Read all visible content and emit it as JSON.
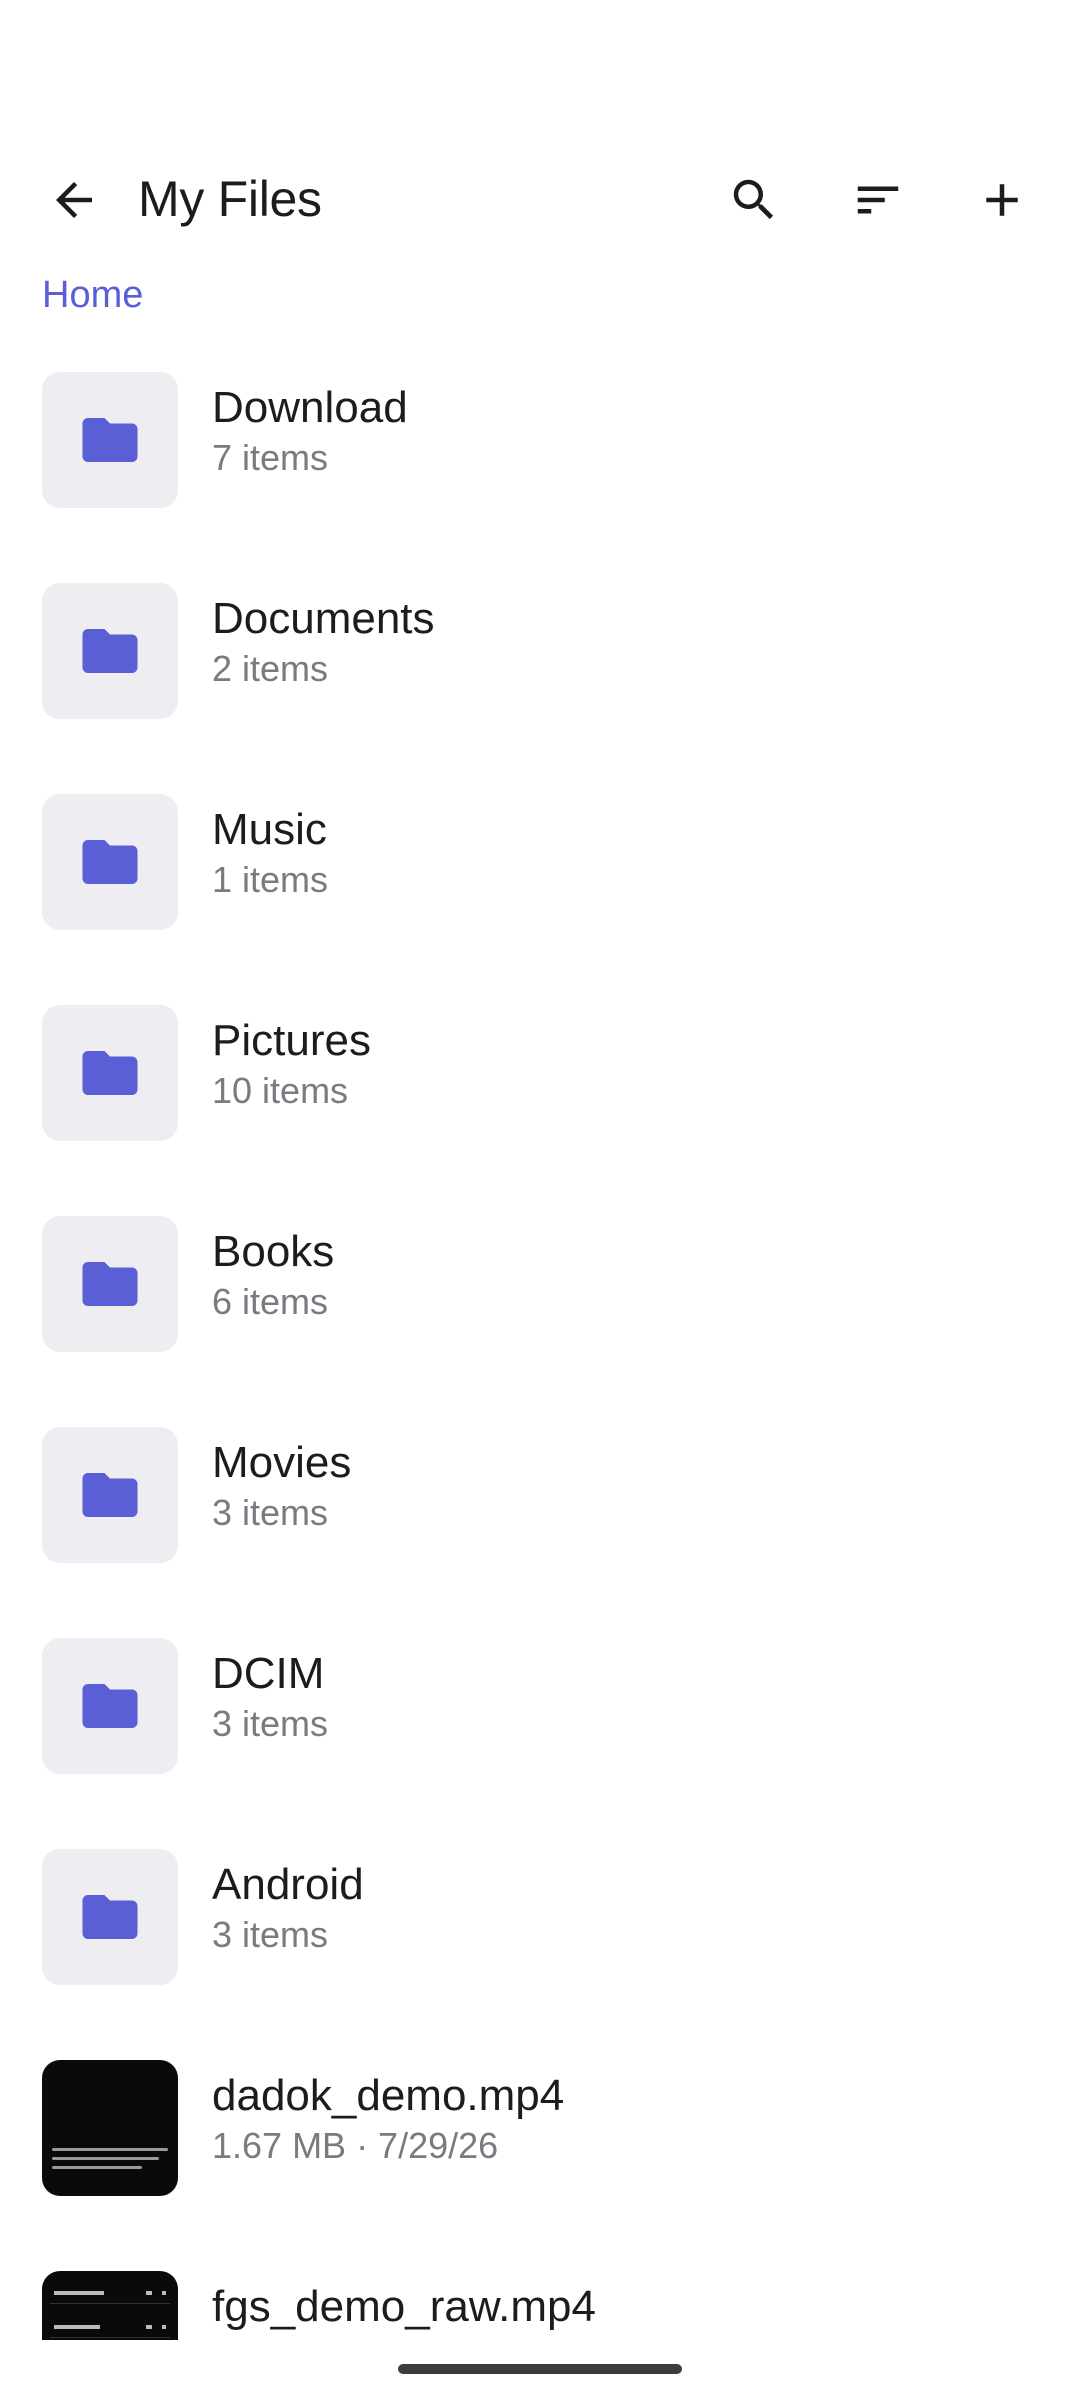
{
  "appbar": {
    "title": "My Files",
    "back_icon": "arrow-left-icon",
    "search_icon": "search-icon",
    "sort_icon": "sort-icon",
    "add_icon": "plus-icon"
  },
  "breadcrumb": {
    "label": "Home"
  },
  "colors": {
    "accent": "#5b5fd6",
    "folder": "#5b5fd6",
    "tile": "#ededf2"
  },
  "items": [
    {
      "name": "Download",
      "meta": "7 items",
      "kind": "folder"
    },
    {
      "name": "Documents",
      "meta": "2 items",
      "kind": "folder"
    },
    {
      "name": "Music",
      "meta": "1 items",
      "kind": "folder"
    },
    {
      "name": "Pictures",
      "meta": "10 items",
      "kind": "folder"
    },
    {
      "name": "Books",
      "meta": "6 items",
      "kind": "folder"
    },
    {
      "name": "Movies",
      "meta": "3 items",
      "kind": "folder"
    },
    {
      "name": "DCIM",
      "meta": "3 items",
      "kind": "folder"
    },
    {
      "name": "Android",
      "meta": "3 items",
      "kind": "folder"
    },
    {
      "name": "dadok_demo.mp4",
      "meta": "1.67 MB · 7/29/26",
      "kind": "video"
    },
    {
      "name": "fgs_demo_raw.mp4",
      "meta": "",
      "kind": "video"
    }
  ]
}
